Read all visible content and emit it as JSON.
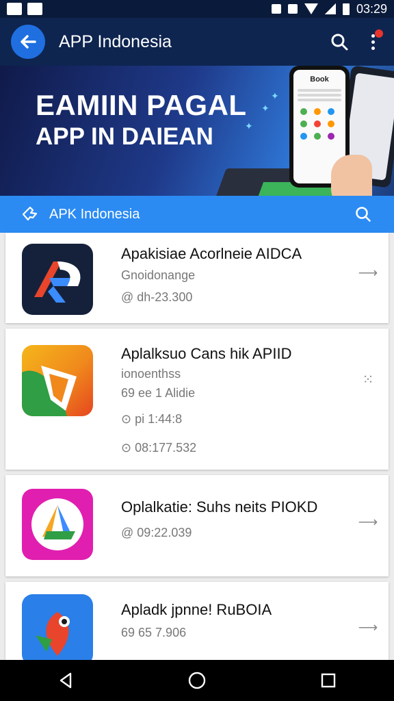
{
  "status_bar": {
    "time": "03:29"
  },
  "app_bar": {
    "title": "APP Indonesia"
  },
  "banner": {
    "line1": "EAMIIN PAGAL",
    "line2": "APP IN DAIEAN",
    "phone_header": "Book"
  },
  "search_bar": {
    "label": "APK Indonesia"
  },
  "apps": [
    {
      "title": "Apakisiae Acorlneie AIDCA",
      "lines": [
        "Gnoidonange",
        "@ dh-23.300"
      ]
    },
    {
      "title": "Aplalksuo Cans hik APIID",
      "lines": [
        "ionoenthss",
        "69 ee 1 Alidie",
        "⊙ pi 1:44:8",
        "⊙ 08:177.532"
      ]
    },
    {
      "title": "Oplalkatie: Suhs neits PIOKD",
      "lines": [
        "@ 09:22.039"
      ]
    },
    {
      "title": "Apladk jpnne! RuBOIA",
      "lines": [
        "69 65 7.906"
      ]
    }
  ],
  "colors": {
    "app_bar": "#0e2550",
    "search_bar": "#2b8bf3",
    "accent": "#1f6fe0"
  }
}
